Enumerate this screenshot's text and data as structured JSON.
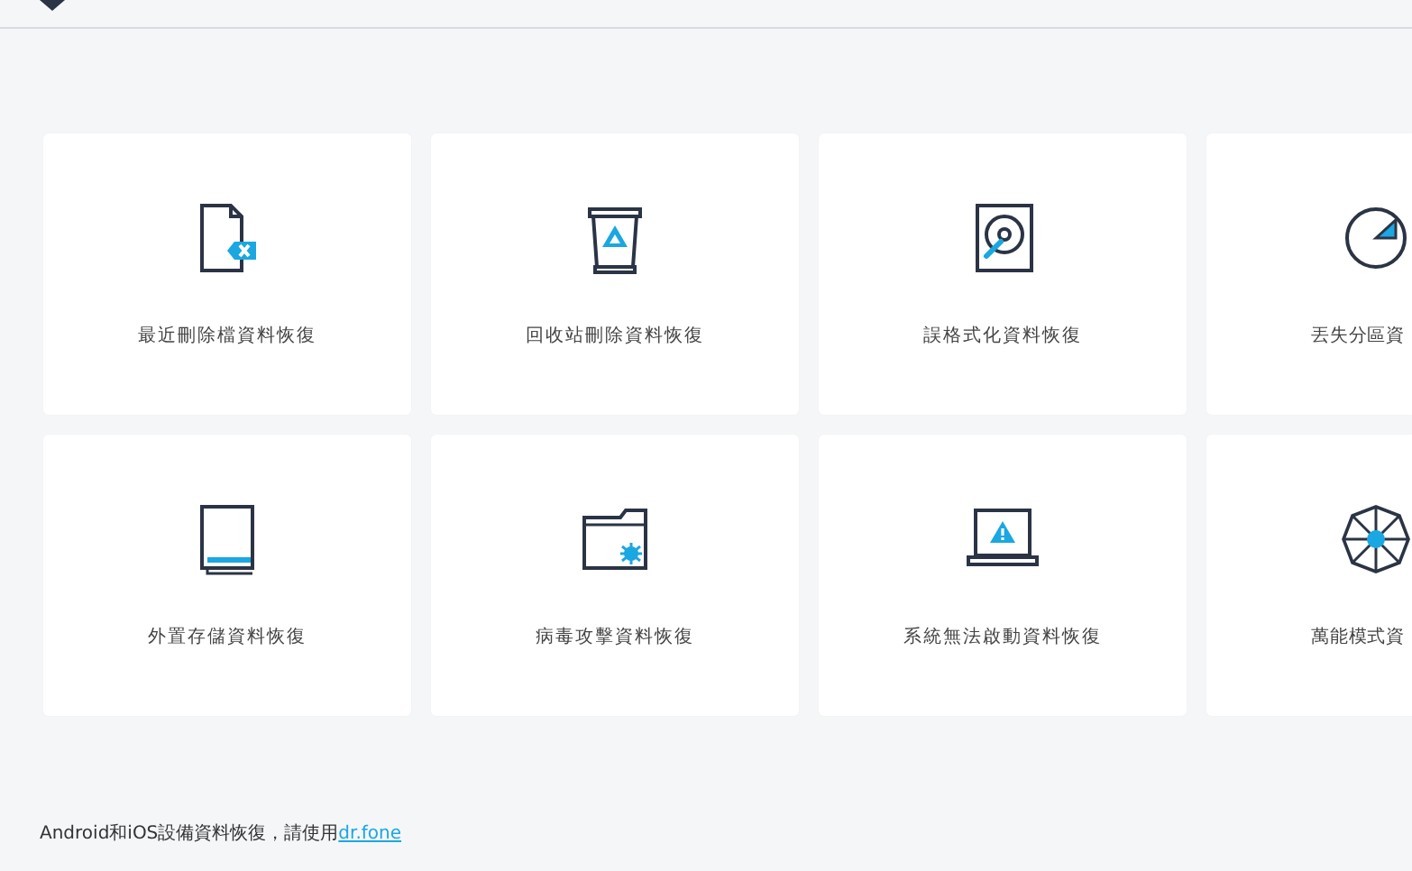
{
  "options": [
    {
      "label": "最近刪除檔資料恢復",
      "kind": "full"
    },
    {
      "label": "回收站刪除資料恢復",
      "kind": "full"
    },
    {
      "label": "誤格式化資料恢復",
      "kind": "full"
    },
    {
      "label": "丟失分區資",
      "kind": "partial"
    },
    {
      "label": "外置存儲資料恢復",
      "kind": "full"
    },
    {
      "label": "病毒攻擊資料恢復",
      "kind": "full"
    },
    {
      "label": "系統無法啟動資料恢復",
      "kind": "full"
    },
    {
      "label": "萬能模式資",
      "kind": "partial"
    }
  ],
  "footer": {
    "text": "Android和iOS設備資料恢復，請使用",
    "link": "dr.fone"
  }
}
